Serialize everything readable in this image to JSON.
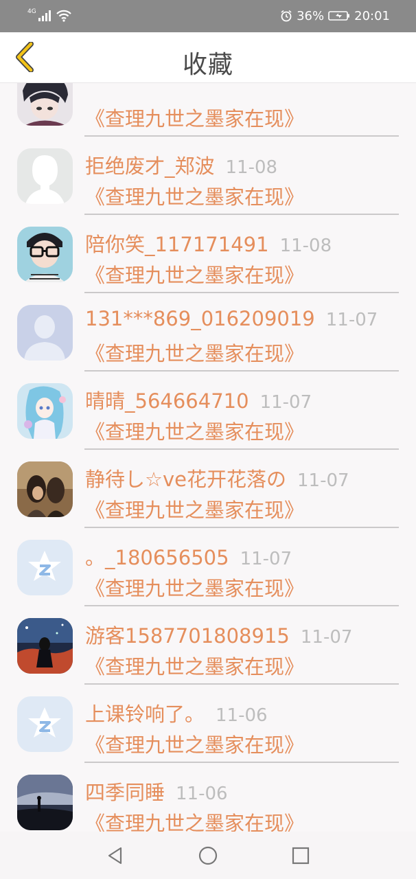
{
  "status_bar": {
    "network": "4G",
    "battery": "36%",
    "time": "20:01"
  },
  "header": {
    "title": "收藏",
    "back_icon": "chevron-left-icon",
    "accent_color": "#f2c318"
  },
  "list": {
    "items": [
      {
        "name": "",
        "date": "",
        "book": "《查理九世之墨家在现》",
        "avatar": "anime-boy"
      },
      {
        "name": "拒绝废才_郑波",
        "date": "11-08",
        "book": "《查理九世之墨家在现》",
        "avatar": "blank-white"
      },
      {
        "name": "陪你笑_117171491",
        "date": "11-08",
        "book": "《查理九世之墨家在现》",
        "avatar": "boy-glasses"
      },
      {
        "name": "131***869_016209019",
        "date": "11-07",
        "book": "《查理九世之墨家在现》",
        "avatar": "default-person"
      },
      {
        "name": "晴晴_564664710",
        "date": "11-07",
        "book": "《查理九世之墨家在现》",
        "avatar": "anime-girl"
      },
      {
        "name": "静待し☆ve花开花落の",
        "date": "11-07",
        "book": "《查理九世之墨家在现》",
        "avatar": "couple-photo"
      },
      {
        "name": "。_180656505",
        "date": "11-07",
        "book": "《查理九世之墨家在现》",
        "avatar": "qq-zone"
      },
      {
        "name": "游客1587701808915",
        "date": "11-07",
        "book": "《查理九世之墨家在现》",
        "avatar": "night-scene"
      },
      {
        "name": "上课铃响了。",
        "date": "11-06",
        "book": "《查理九世之墨家在现》",
        "avatar": "qq-zone"
      },
      {
        "name": "四季同睡",
        "date": "11-06",
        "book": "《查理九世之墨家在现》",
        "avatar": "dusk-landscape"
      }
    ]
  },
  "nav_bar": {
    "back": "triangle-back-icon",
    "home": "circle-home-icon",
    "recents": "square-recents-icon"
  },
  "colors": {
    "name_text": "#e58e5c",
    "date_text": "#bdbdbd",
    "divider": "#cbc9ca",
    "status_bar_bg": "#8a8a8a"
  }
}
